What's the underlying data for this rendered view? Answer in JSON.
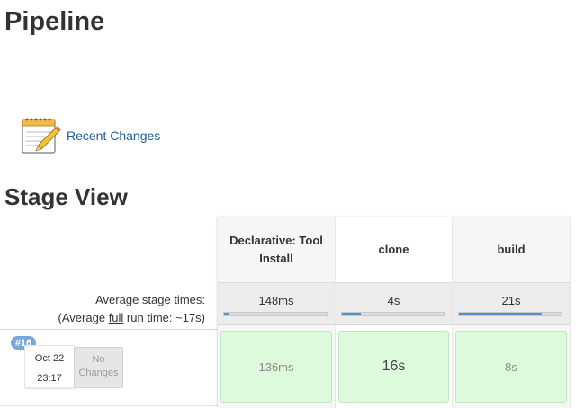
{
  "page": {
    "title": "Pipeline",
    "recent_changes_label": "Recent Changes",
    "stage_view_title": "Stage View"
  },
  "summary": {
    "avg_stage_label": "Average stage times:",
    "avg_full_prefix": "(Average ",
    "avg_full_link": "full",
    "avg_full_suffix": " run time: ~17s)"
  },
  "stages": [
    {
      "name": "Declarative: Tool Install",
      "avg_time": "148ms",
      "avg_fraction": 0.05,
      "runs": [
        "136ms"
      ]
    },
    {
      "name": "clone",
      "avg_time": "4s",
      "avg_fraction": 0.19,
      "runs": [
        "16s"
      ]
    },
    {
      "name": "build",
      "avg_time": "21s",
      "avg_fraction": 0.81,
      "runs": [
        "8s"
      ]
    }
  ],
  "runs": [
    {
      "number": "#16",
      "date": "Oct 22",
      "time": "23:17",
      "changes": "No Changes"
    }
  ],
  "colors": {
    "link": "#1f6198",
    "success_cell": "#ddfadd",
    "progress": "#5b8fd4",
    "badge": "#7aa6d6"
  },
  "icons": {
    "recent_changes": "notepad-pencil-icon"
  }
}
